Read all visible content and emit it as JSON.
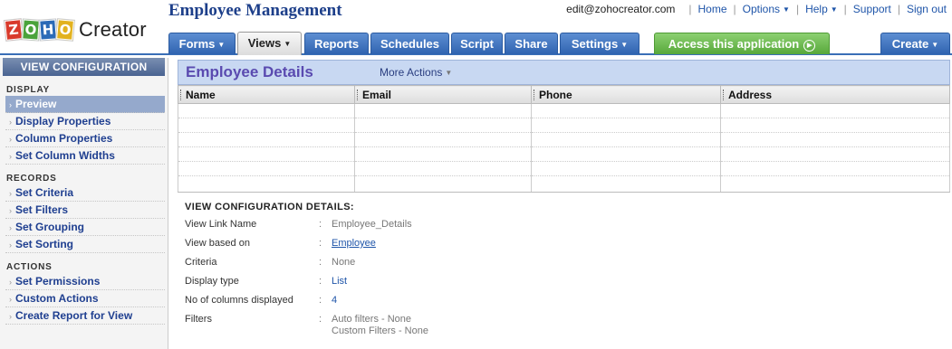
{
  "logo": {
    "tiles": [
      "Z",
      "O",
      "H",
      "O"
    ],
    "product": "Creator"
  },
  "app_title": "Employee Management",
  "topnav": {
    "user": "edit@zohocreator.com",
    "links": [
      "Home",
      "Options",
      "Help",
      "Support",
      "Sign out"
    ]
  },
  "tabs": {
    "forms": "Forms",
    "views": "Views",
    "reports": "Reports",
    "schedules": "Schedules",
    "script": "Script",
    "share": "Share",
    "settings": "Settings",
    "access": "Access this application",
    "create": "Create"
  },
  "sidebar": {
    "header": "VIEW CONFIGURATION",
    "sections": [
      {
        "title": "Display",
        "items": [
          "Preview",
          "Display Properties",
          "Column Properties",
          "Set Column Widths"
        ]
      },
      {
        "title": "Records",
        "items": [
          "Set Criteria",
          "Set Filters",
          "Set Grouping",
          "Set Sorting"
        ]
      },
      {
        "title": "Actions",
        "items": [
          "Set Permissions",
          "Custom Actions",
          "Create Report for View"
        ]
      }
    ],
    "active_item": "Preview"
  },
  "view": {
    "title": "Employee Details",
    "more_actions": "More Actions",
    "columns": [
      "Name",
      "Email",
      "Phone",
      "Address"
    ]
  },
  "details": {
    "heading": "VIEW CONFIGURATION DETAILS:",
    "rows": [
      {
        "label": "View Link Name",
        "value": "Employee_Details"
      },
      {
        "label": "View based on",
        "value": "Employee"
      },
      {
        "label": "Criteria",
        "value": "None"
      },
      {
        "label": "Display type",
        "value": "List"
      },
      {
        "label": "No of columns displayed",
        "value": "4"
      },
      {
        "label": "Filters",
        "value": "Auto filters - None",
        "value2": "Custom Filters - None"
      }
    ]
  },
  "colors": {
    "tab_blue": "#3a6fb7",
    "tab_green": "#5fae42",
    "title_purple": "#5a4ab0",
    "link_blue": "#1f55a9"
  }
}
